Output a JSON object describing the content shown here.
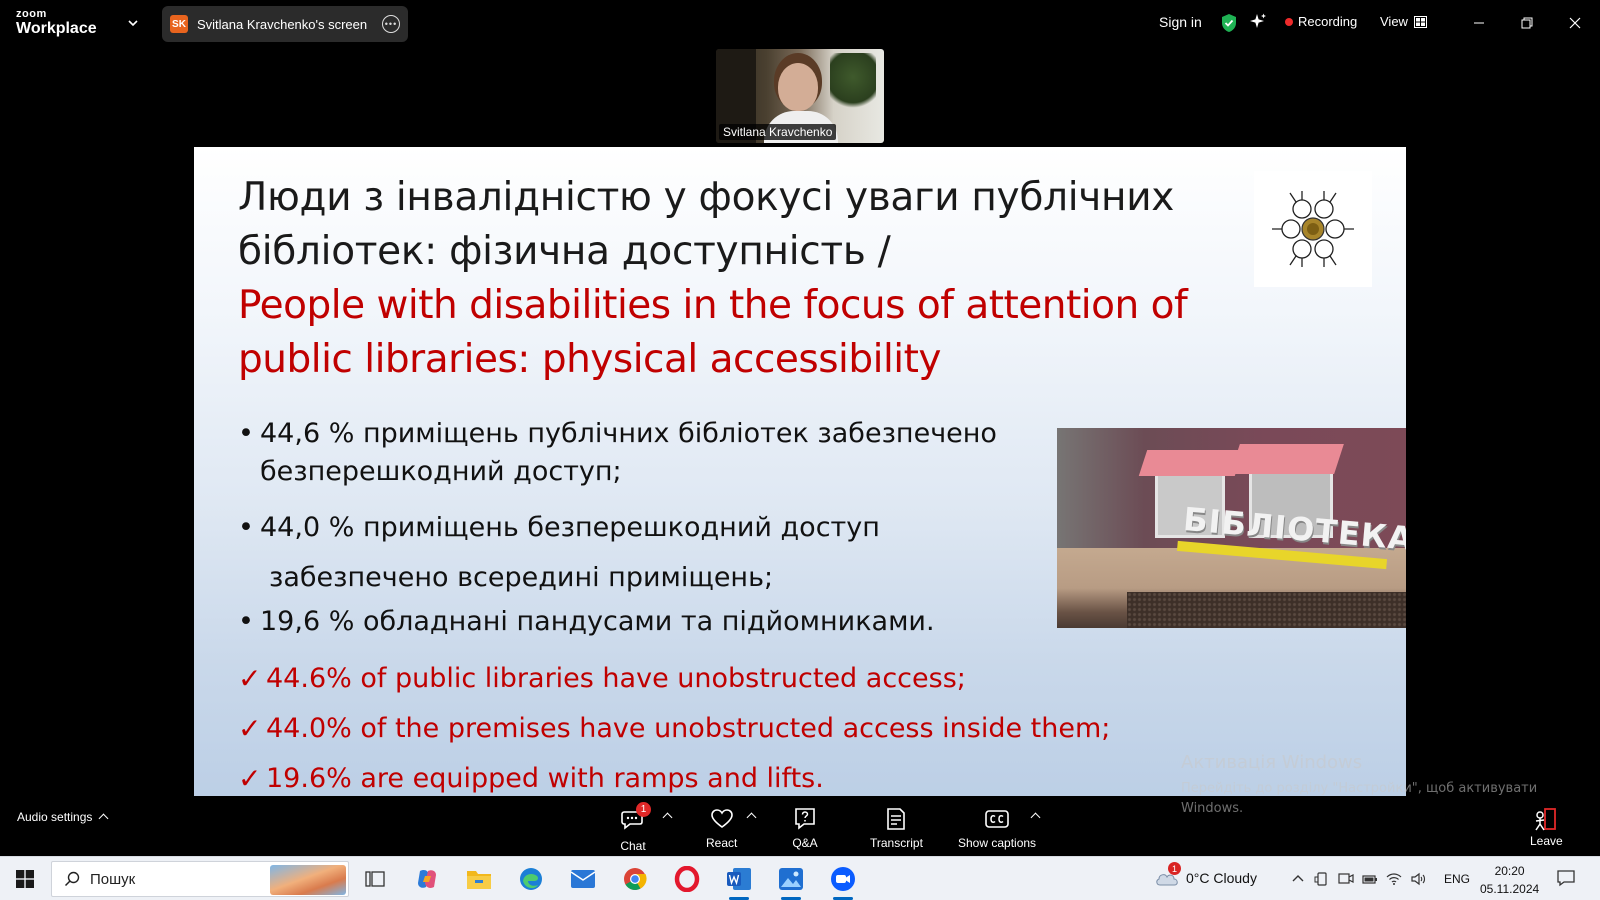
{
  "app": {
    "logo_top": "zoom",
    "logo_bottom": "Workplace",
    "share_initials": "SK",
    "share_title": "Svitlana Kravchenko's screen",
    "sign_in": "Sign in",
    "recording": "Recording",
    "view": "View"
  },
  "video": {
    "participant_name": "Svitlana Kravchenko"
  },
  "slide": {
    "title_ua_line1": "Люди з інвалідністю у фокусі уваги публічних",
    "title_ua_line2": "бібліотек: фізична доступність /",
    "title_en_line1": "People with disabilities in the focus of attention of",
    "title_en_line2": "public libraries: physical accessibility",
    "bullets": [
      {
        "line1": "44,6 % приміщень публічних бібліотек забезпечено",
        "line2": "безперешкодний доступ;"
      },
      {
        "line1": "44,0 % приміщень безперешкодний доступ",
        "line2": "забезпечено всередині приміщень;"
      },
      {
        "line1": "19,6 % обладнані пандусами та підйомниками."
      }
    ],
    "check_mark": "✓",
    "checks": [
      "44.6% of public libraries have unobstructed access;",
      "44.0% of the premises have unobstructed access inside them;",
      "19.6% are equipped with ramps and lifts."
    ],
    "photo_sign": "БІБЛІОТЕКА"
  },
  "watermark": {
    "line1": "Активація Windows",
    "line2": "Перейдіть до розділу \"Настройки\", щоб активувати Windows."
  },
  "toolbar": {
    "audio_settings": "Audio settings",
    "chat": "Chat",
    "chat_badge": "1",
    "react": "React",
    "qa": "Q&A",
    "transcript": "Transcript",
    "captions": "Show captions",
    "leave": "Leave"
  },
  "taskbar": {
    "search_placeholder": "Пошук",
    "weather": "0°C  Cloudy",
    "weather_badge": "1",
    "lang": "ENG",
    "time": "20:20",
    "date": "05.11.2024"
  },
  "colors": {
    "accent_red": "#c00000",
    "recording_red": "#ee2b2b",
    "shield_green": "#1fb254",
    "windows_blue": "#0067c0"
  }
}
